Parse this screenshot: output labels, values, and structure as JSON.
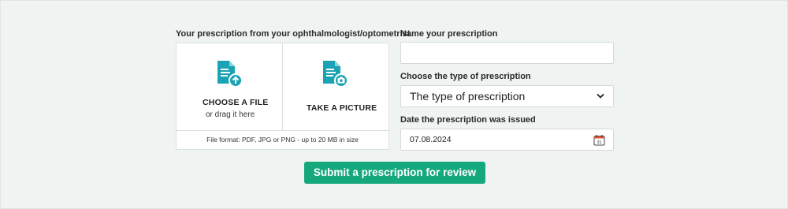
{
  "upload": {
    "section_label": "Your prescription from your ophthalmologist/optometrist",
    "choose_file": {
      "title": "CHOOSE A FILE",
      "subtitle": "or drag it here",
      "icon": "file-upload-icon"
    },
    "take_picture": {
      "title": "TAKE A PICTURE",
      "icon": "file-camera-icon"
    },
    "format_note": "File format: PDF, JPG or PNG - up to 20 MB in size"
  },
  "name_field": {
    "label": "Name your prescription",
    "value": "",
    "placeholder": ""
  },
  "type_field": {
    "label": "Choose the type of prescription",
    "selected": "The type of prescription"
  },
  "date_field": {
    "label": "Date the prescription was issued",
    "value": "07.08.2024",
    "calendar_day": "31"
  },
  "submit": {
    "label": "Submit a prescription for review"
  },
  "colors": {
    "accent": "#16a87d",
    "icon_teal": "#1aa3b4",
    "background": "#eff3f1"
  }
}
